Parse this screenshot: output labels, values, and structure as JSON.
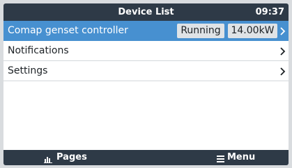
{
  "header": {
    "title": "Device List",
    "time": "09:37"
  },
  "list": {
    "items": [
      {
        "label": "Comap genset controller",
        "status": "Running",
        "power": "14.00kW"
      },
      {
        "label": "Notifications"
      },
      {
        "label": "Settings"
      }
    ]
  },
  "footer": {
    "pages_label": "Pages",
    "menu_label": "Menu"
  },
  "colors": {
    "header_bg": "#2e3a47",
    "selected_bg": "#4790d0",
    "badge_bg": "#dfe3e6",
    "footer_bg": "#2e3a47"
  },
  "icons": {
    "pages": "bar-chart-icon",
    "menu": "hamburger-icon",
    "row": "chevron-right-icon"
  }
}
